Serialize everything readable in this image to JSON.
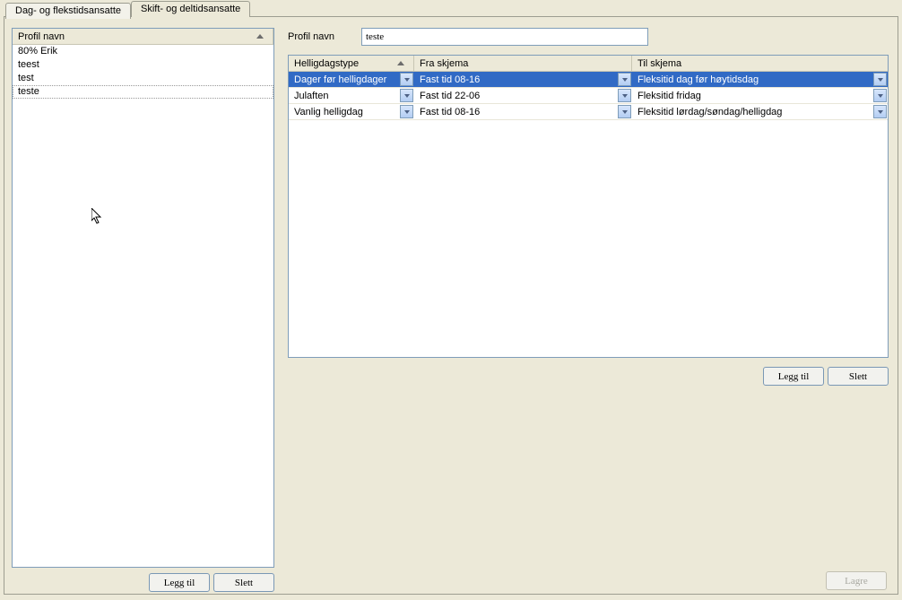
{
  "tabs": {
    "tab1": "Dag- og flekstidsansatte",
    "tab2": "Skift- og deltidsansatte"
  },
  "leftList": {
    "header": "Profil navn",
    "items": [
      "80% Erik",
      "teest",
      "test",
      "teste"
    ],
    "selectedIndex": 3
  },
  "leftButtons": {
    "add": "Legg til",
    "delete": "Slett"
  },
  "profile": {
    "label": "Profil navn",
    "value": "teste"
  },
  "grid": {
    "headers": {
      "type": "Helligdagstype",
      "from": "Fra skjema",
      "to": "Til skjema"
    },
    "rows": [
      {
        "type": "Dager før helligdager",
        "from": "Fast tid 08-16",
        "to": "Fleksitid dag før høytidsdag",
        "selected": true
      },
      {
        "type": "Julaften",
        "from": "Fast tid 22-06",
        "to": "Fleksitid fridag",
        "selected": false
      },
      {
        "type": "Vanlig helligdag",
        "from": "Fast tid 08-16",
        "to": "Fleksitid lørdag/søndag/helligdag",
        "selected": false
      }
    ]
  },
  "rightButtons": {
    "add": "Legg til",
    "delete": "Slett"
  },
  "save": "Lagre"
}
